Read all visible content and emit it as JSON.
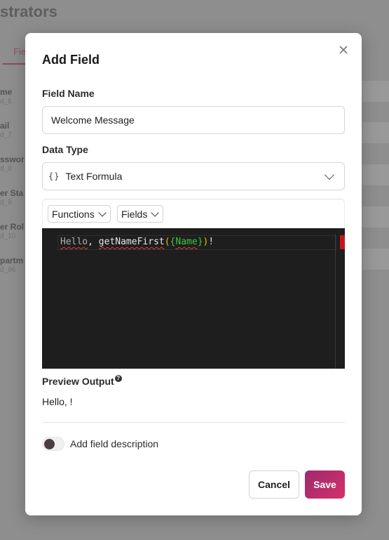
{
  "background": {
    "page_title": "strators",
    "tab_label": "Fie",
    "rows": [
      {
        "name": "me",
        "id": "d_6"
      },
      {
        "name": "ail",
        "id": "d_7"
      },
      {
        "name": "sswor",
        "id": "d_8"
      },
      {
        "name": "er Sta",
        "id": "d_9"
      },
      {
        "name": "er Rol",
        "id": "d_10"
      },
      {
        "name": "partm",
        "id": "d_96"
      }
    ]
  },
  "modal": {
    "title": "Add Field",
    "close_icon": "close-icon",
    "field_name": {
      "label": "Field Name",
      "value": "Welcome Message"
    },
    "data_type": {
      "label": "Data Type",
      "icon": "{}",
      "selected": "Text Formula"
    },
    "toolbar": {
      "functions_label": "Functions",
      "fields_label": "Fields"
    },
    "editor": {
      "tokens": {
        "hello": "Hello",
        "comma_space": ", ",
        "function_name": "getNameFirst",
        "open_paren": "(",
        "open_brace": "{",
        "field_name": "Name",
        "close_brace": "}",
        "close_paren": ")",
        "bang": "!"
      },
      "error_marker_color": "#c4161c"
    },
    "preview": {
      "label": "Preview Output",
      "help_icon": "?",
      "value": "Hello, !"
    },
    "description_toggle": {
      "label": "Add field description",
      "enabled": false
    },
    "buttons": {
      "cancel": "Cancel",
      "save": "Save"
    },
    "colors": {
      "save_gradient_start": "#9e2a6e",
      "save_gradient_end": "#d4306a",
      "editor_bg": "#1e1e1e"
    }
  }
}
